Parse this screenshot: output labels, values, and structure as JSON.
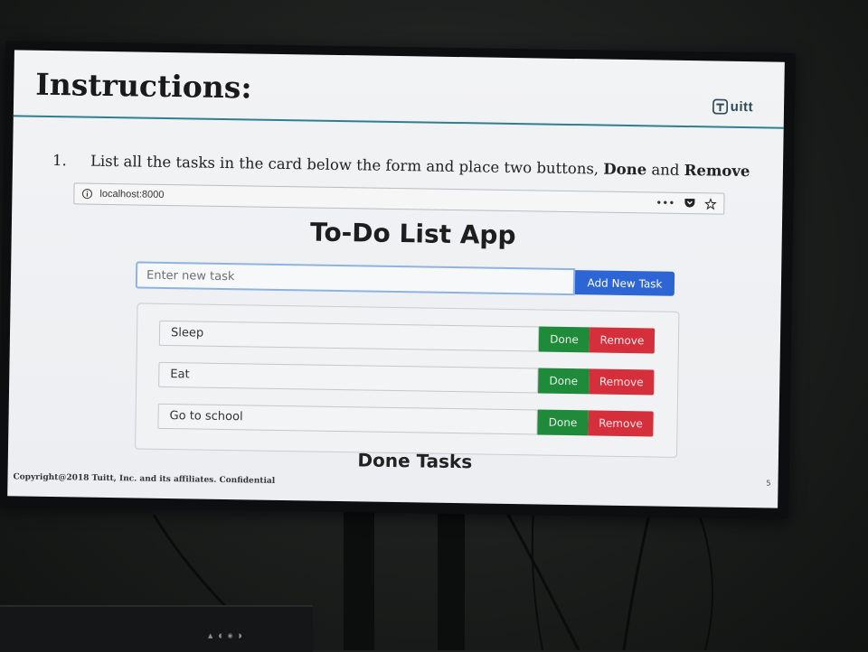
{
  "slide": {
    "title": "Instructions:",
    "logo_text": "uitt",
    "instruction": {
      "number": "1.",
      "text_before": "List all the tasks in the card below the form and place two buttons, ",
      "bold_1": "Done",
      "text_middle": " and ",
      "bold_2": "Remove"
    },
    "copyright": "Copyright@2018 Tuitt, Inc. and its affiliates. Confidential",
    "page_number": "5"
  },
  "browser": {
    "url": "localhost:8000",
    "actions": [
      "•••",
      "pocket-icon",
      "star-icon"
    ]
  },
  "app": {
    "title": "To-Do List App",
    "input_placeholder": "Enter new task",
    "add_button_label": "Add New Task",
    "tasks": [
      {
        "name": "Sleep",
        "done_label": "Done",
        "remove_label": "Remove"
      },
      {
        "name": "Eat",
        "done_label": "Done",
        "remove_label": "Remove"
      },
      {
        "name": "Go to school",
        "done_label": "Done",
        "remove_label": "Remove"
      }
    ],
    "done_heading": "Done Tasks"
  },
  "colors": {
    "accent_rule": "#2f7f8f",
    "add_button": "#2d66d4",
    "done_button": "#1f8a3a",
    "remove_button": "#d62f3c"
  }
}
